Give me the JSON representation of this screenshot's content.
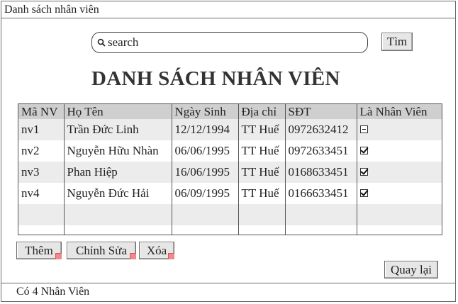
{
  "window": {
    "title": "Danh sách nhân viên"
  },
  "search": {
    "placeholder": "search",
    "button_label": "Tìm"
  },
  "page": {
    "heading": "DANH SÁCH NHÂN VIÊN"
  },
  "table": {
    "headers": [
      "Mã NV",
      "Họ Tên",
      "Ngày Sinh",
      "Địa chỉ",
      "SĐT",
      "Là Nhân Viên"
    ],
    "rows": [
      {
        "ma_nv": "nv1",
        "ho_ten": "Trần Đức Linh",
        "ngay_sinh": "12/12/1994",
        "dia_chi": "TT Huế",
        "sdt": "0972632412",
        "la_nhan_vien": "partial"
      },
      {
        "ma_nv": "nv2",
        "ho_ten": "Nguyễn Hữu Nhàn",
        "ngay_sinh": "06/06/1995",
        "dia_chi": "TT Huế",
        "sdt": "0972633451",
        "la_nhan_vien": "checked"
      },
      {
        "ma_nv": "nv3",
        "ho_ten": "Phan Hiệp",
        "ngay_sinh": "16/06/1995",
        "dia_chi": "TT Huế",
        "sdt": "0168633451",
        "la_nhan_vien": "checked"
      },
      {
        "ma_nv": "nv4",
        "ho_ten": "Nguyễn Đức Hải",
        "ngay_sinh": "06/09/1995",
        "dia_chi": "TT Huế",
        "sdt": "0166633451",
        "la_nhan_vien": "checked"
      }
    ]
  },
  "actions": {
    "add_label": "Thêm",
    "edit_label": "Chỉnh Sửa",
    "delete_label": "Xóa",
    "back_label": "Quay lại"
  },
  "status": {
    "text": "Có 4 Nhân Viên"
  },
  "colors": {
    "header_bg": "#cfcfcf",
    "alt_row_bg": "#ececec",
    "button_bg": "#e6e6e6",
    "corner_marker": "#f08a8a"
  }
}
